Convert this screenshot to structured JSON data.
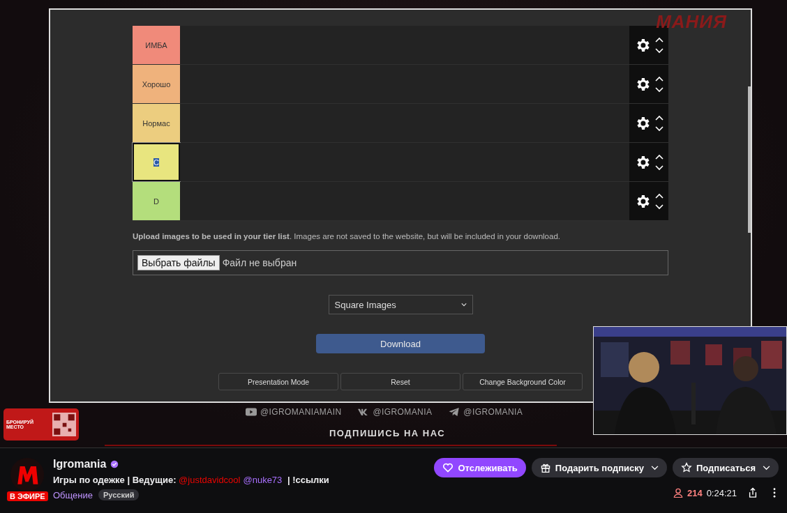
{
  "stream_overlay": {
    "logo": "МАНИЯ",
    "sponsor": "БРОНИРУЙ МЕСТО",
    "socials": [
      {
        "kind": "youtube",
        "handle": "@IGROMANIAMAIN"
      },
      {
        "kind": "vk",
        "handle": "@IGROMANIA"
      },
      {
        "kind": "telegram",
        "handle": "@IGROMANIA"
      }
    ],
    "subscribe": "ПОДПИШИСЬ НА НАС"
  },
  "tier_list": {
    "tiers": [
      {
        "label": "ИМБА",
        "color": "#f08a7a",
        "editing": false
      },
      {
        "label": "Хорошо",
        "color": "#efb27c",
        "editing": false
      },
      {
        "label": "Нормас",
        "color": "#eccd7f",
        "editing": false
      },
      {
        "label": "C",
        "color": "#e8e57f",
        "editing": true
      },
      {
        "label": "D",
        "color": "#b4de7c",
        "editing": false
      }
    ],
    "upload_note_bold": "Upload images to be used in your tier list",
    "upload_note": ". Images are not saved to the website, but will be included in your download.",
    "file_button": "Выбрать файлы",
    "file_status": "Файл не выбран",
    "image_shape": "Square Images",
    "download": "Download",
    "buttons": [
      "Presentation Mode",
      "Reset",
      "Change Background Color"
    ]
  },
  "channel": {
    "name": "Igromania",
    "verified": true,
    "live_badge": "В ЭФИРЕ",
    "title_parts": [
      {
        "kind": "text",
        "text": "Игры по одежке | Ведущие: "
      },
      {
        "kind": "mention",
        "text": "@justdavidcool",
        "color": "#eb0400"
      },
      {
        "kind": "mention",
        "text": "@nuke73",
        "color": "#a970ff"
      },
      {
        "kind": "text",
        "text": " | !ссылки"
      }
    ],
    "category": "Общение",
    "tag": "Русский",
    "follow": "Отслеживать",
    "gift": "Подарить подписку",
    "subscribe": "Подписаться",
    "viewers": "214",
    "uptime": "0:24:21"
  }
}
